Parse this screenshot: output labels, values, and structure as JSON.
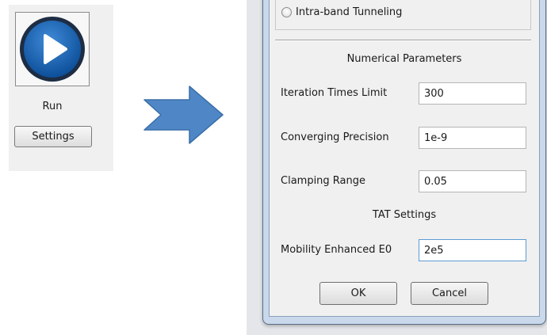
{
  "run_panel": {
    "run_label": "Run",
    "settings_label": "Settings"
  },
  "arrow": {
    "color": "#4f87c6"
  },
  "dialog": {
    "radio_option": "Intra-band Tunneling",
    "numerical_section_title": "Numerical Parameters",
    "fields": [
      {
        "label": "Iteration Times Limit",
        "value": "300"
      },
      {
        "label": "Converging Precision",
        "value": "1e-9"
      },
      {
        "label": "Clamping Range",
        "value": "0.05"
      }
    ],
    "tat_section_title": "TAT Settings",
    "tat_field": {
      "label": "Mobility Enhanced E0",
      "value": "2e5"
    },
    "ok_label": "OK",
    "cancel_label": "Cancel"
  },
  "colors": {
    "accent": "#1f63b5",
    "frame": "#c9d8ea",
    "focus": "#5b9bd5"
  },
  "icons": {
    "run": "play-icon"
  }
}
